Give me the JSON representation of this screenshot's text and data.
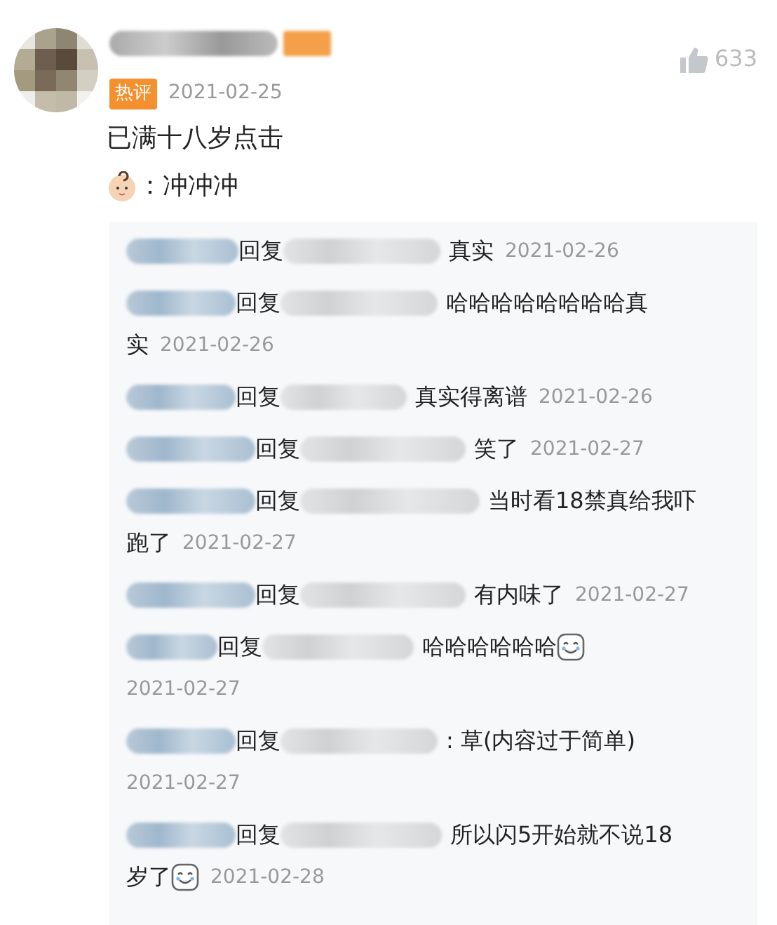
{
  "comment": {
    "badge": "热评",
    "date": "2021-02-25",
    "likes": "633",
    "lines": [
      "已满十八岁点击",
      "：冲冲冲"
    ]
  },
  "replies": [
    {
      "verb": "回复",
      "text": "真实",
      "has_emoji": false,
      "date_wraps": false,
      "date": "2021-02-26"
    },
    {
      "verb": "回复",
      "text": "哈哈哈哈哈哈哈哈真",
      "text_cont": "实",
      "has_emoji": false,
      "date_wraps": false,
      "date": "2021-02-26"
    },
    {
      "verb": "回复",
      "text": "真实得离谱",
      "has_emoji": false,
      "date_wraps": false,
      "date": "2021-02-26"
    },
    {
      "verb": "回复",
      "text": "笑了",
      "has_emoji": false,
      "date_wraps": false,
      "date": "2021-02-27"
    },
    {
      "verb": "回复",
      "text": "当时看18禁真给我吓",
      "text_cont": "跑了",
      "has_emoji": false,
      "date_wraps": false,
      "date": "2021-02-27"
    },
    {
      "verb": "回复",
      "text": "有内味了",
      "has_emoji": false,
      "date_wraps": false,
      "date": "2021-02-27"
    },
    {
      "verb": "回复",
      "text": "哈哈哈哈哈哈",
      "has_emoji": true,
      "date_wraps": true,
      "date": "2021-02-27"
    },
    {
      "verb": "回复",
      "text": ": 草(内容过于简单)",
      "has_emoji": false,
      "date_wraps": true,
      "date": "2021-02-27"
    },
    {
      "verb": "回复",
      "text": "所以闪5开始就不说18",
      "text_cont": "岁了",
      "has_emoji": true,
      "date_wraps": false,
      "date": "2021-02-28"
    }
  ]
}
